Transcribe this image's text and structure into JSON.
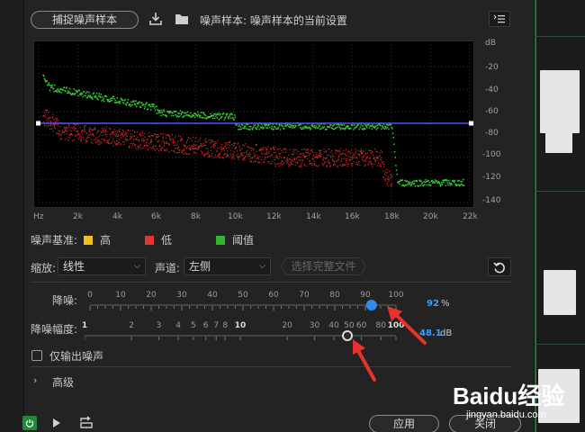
{
  "header": {
    "capture_button": "捕捉噪声样本",
    "title": "噪声样本: 噪声样本的当前设置"
  },
  "graph": {
    "db_labels": [
      "dB",
      "-20",
      "-40",
      "-60",
      "-80",
      "-100",
      "-120",
      "-140"
    ],
    "freq_labels": [
      "Hz",
      "2k",
      "4k",
      "6k",
      "8k",
      "10k",
      "12k",
      "14k",
      "16k",
      "18k",
      "20k",
      "22k"
    ],
    "threshold_db": -70
  },
  "legend": {
    "title": "噪声基准:",
    "items": [
      {
        "label": "高",
        "color": "#f2c01e"
      },
      {
        "label": "低",
        "color": "#e23636"
      },
      {
        "label": "阈值",
        "color": "#2fb52f"
      }
    ]
  },
  "controls": {
    "scale_label": "缩放:",
    "scale_value": "线性",
    "channel_label": "声道:",
    "channel_value": "左侧",
    "select_file_button": "选择完整文件"
  },
  "noise_reduction": {
    "label": "降噪:",
    "ticks": [
      "0",
      "10",
      "20",
      "30",
      "40",
      "50",
      "60",
      "70",
      "80",
      "90",
      "100"
    ],
    "value": "92",
    "unit": "%",
    "fraction": 0.92
  },
  "reduction_amount": {
    "label": "降噪幅度:",
    "ticks": [
      "1",
      "2",
      "3",
      "4",
      "5",
      "6",
      "7",
      "8",
      "10",
      "20",
      "30",
      "40",
      "50",
      "60",
      "80",
      "100"
    ],
    "value": "48.1",
    "unit": "dB"
  },
  "output_noise_only": "仅输出噪声",
  "advanced": "高级",
  "footer": {
    "apply": "应用",
    "close": "关闭"
  },
  "watermark": {
    "brand": "Baidu经验",
    "url": "jingyan.baidu.com"
  }
}
